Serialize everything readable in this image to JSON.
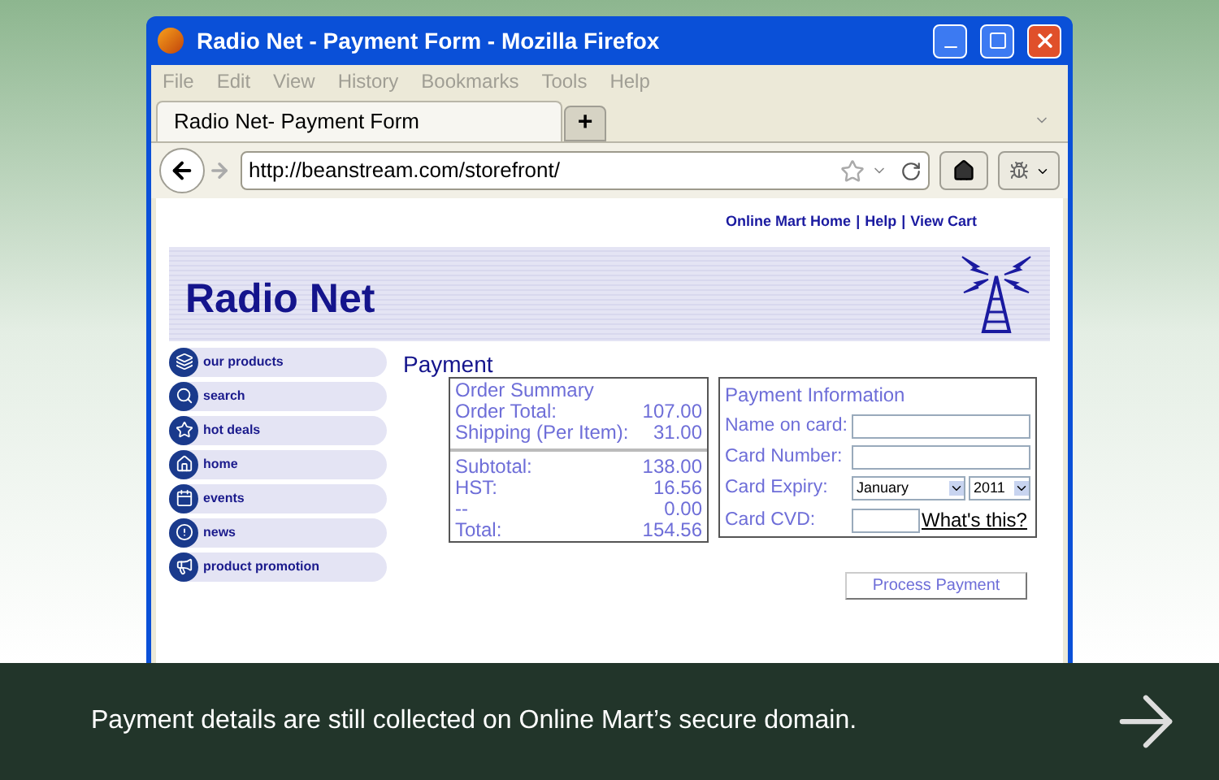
{
  "window": {
    "title": "Radio Net - Payment Form - Mozilla Firefox"
  },
  "menu": [
    "File",
    "Edit",
    "View",
    "History",
    "Bookmarks",
    "Tools",
    "Help"
  ],
  "tabs": [
    {
      "label": "Radio Net- Payment Form",
      "selected": true
    }
  ],
  "new_tab": "+",
  "address": "http://beanstream.com/storefront/",
  "top_links": [
    {
      "label": "Online Mart Home"
    },
    {
      "label": "Help"
    },
    {
      "label": "View Cart"
    }
  ],
  "link_separator": "|",
  "site_title": "Radio Net",
  "nav": [
    {
      "label": "our products",
      "kind": "products"
    },
    {
      "label": "search",
      "kind": "search"
    },
    {
      "label": "hot deals",
      "kind": "star"
    },
    {
      "label": "home",
      "kind": "home"
    },
    {
      "label": "events",
      "kind": "events"
    },
    {
      "label": "news",
      "kind": "news"
    },
    {
      "label": "product promotion",
      "kind": "promo"
    }
  ],
  "heading": "Payment",
  "order_summary": {
    "title": "Order Summary",
    "rows": [
      {
        "label": "Order Total:",
        "value": "107.00"
      },
      {
        "label": "Shipping (Per Item):",
        "value": "31.00"
      }
    ],
    "totals": [
      {
        "label": "Subtotal:",
        "value": "138.00"
      },
      {
        "label": "HST:",
        "value": "16.56"
      },
      {
        "label": "--",
        "value": "0.00"
      },
      {
        "label": "Total:",
        "value": "154.56"
      }
    ]
  },
  "payment_info": {
    "title": "Payment Information",
    "name_label": "Name on card:",
    "number_label": "Card Number:",
    "expiry_label": "Card Expiry:",
    "expiry_month": "January",
    "expiry_year": "2011",
    "cvd_label": "Card CVD:",
    "help_link": "What's this?"
  },
  "process_button": "Process Payment",
  "caption": "Payment details are still collected on Online Mart’s secure domain."
}
